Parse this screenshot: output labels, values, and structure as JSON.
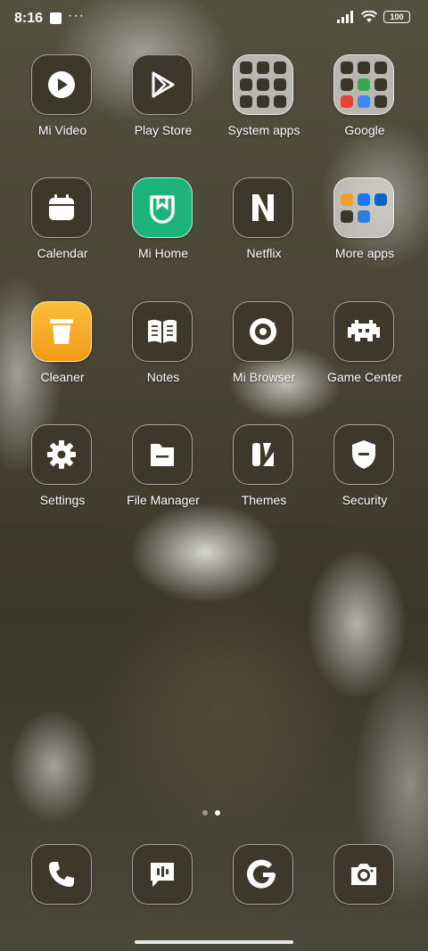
{
  "status_bar": {
    "time": "8:16",
    "battery": "100"
  },
  "apps": [
    {
      "label": "Mi Video",
      "icon": "play-icon"
    },
    {
      "label": "Play Store",
      "icon": "play-store-icon"
    },
    {
      "label": "System apps",
      "icon": "folder-icon"
    },
    {
      "label": "Google",
      "icon": "folder-icon"
    },
    {
      "label": "Calendar",
      "icon": "calendar-icon"
    },
    {
      "label": "Mi Home",
      "icon": "mi-home-icon"
    },
    {
      "label": "Netflix",
      "icon": "netflix-icon"
    },
    {
      "label": "More apps",
      "icon": "folder-icon"
    },
    {
      "label": "Cleaner",
      "icon": "trash-icon"
    },
    {
      "label": "Notes",
      "icon": "book-icon"
    },
    {
      "label": "Mi Browser",
      "icon": "browser-icon"
    },
    {
      "label": "Game Center",
      "icon": "invader-icon"
    },
    {
      "label": "Settings",
      "icon": "gear-icon"
    },
    {
      "label": "File Manager",
      "icon": "file-icon"
    },
    {
      "label": "Themes",
      "icon": "themes-icon"
    },
    {
      "label": "Security",
      "icon": "shield-icon"
    }
  ],
  "dock": [
    {
      "name": "phone",
      "icon": "phone-icon"
    },
    {
      "name": "messages",
      "icon": "message-icon"
    },
    {
      "name": "google",
      "icon": "google-g-icon"
    },
    {
      "name": "camera",
      "icon": "camera-icon"
    }
  ],
  "page_indicator": {
    "pages": 2,
    "active": 2
  },
  "colors": {
    "icon_bg": "#3d382a",
    "mi_home": "#1db37c",
    "cleaner": "#f5a51c"
  }
}
